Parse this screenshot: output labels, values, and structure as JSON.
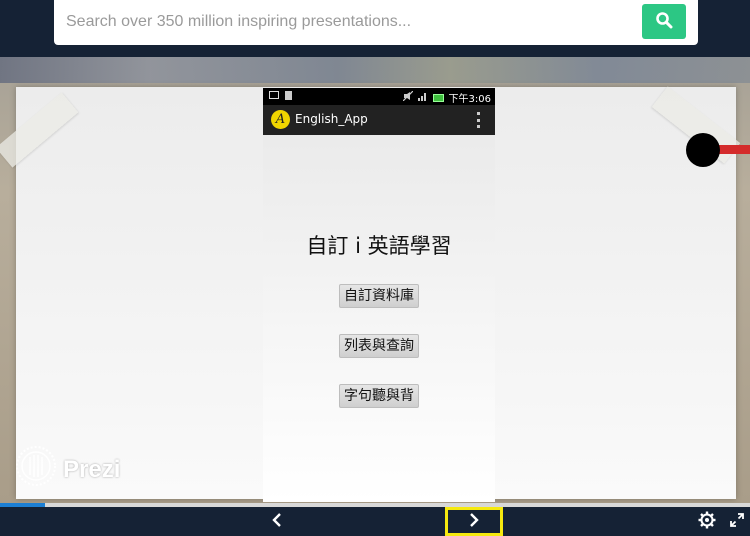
{
  "search": {
    "placeholder": "Search over 350 million inspiring presentations..."
  },
  "phone": {
    "status_time": "下午3:06",
    "app_name": "English_App",
    "app_logo_glyph": "A",
    "heading": "自訂 i 英語學習",
    "buttons": [
      {
        "label": "自訂資料庫"
      },
      {
        "label": "列表與查詢"
      },
      {
        "label": "字句聽與背"
      }
    ]
  },
  "branding": {
    "logo_text": "Prezi"
  },
  "progress": {
    "fraction": 0.06
  },
  "colors": {
    "header_bg": "#152235",
    "search_button": "#2cc784",
    "progress_fill": "#1c7fd4",
    "next_highlight": "#f5e90f",
    "pin_red": "#d42b2b"
  },
  "icons": {
    "search": "search-icon",
    "prev": "chevron-left-icon",
    "next": "chevron-right-icon",
    "settings": "gear-icon",
    "fullscreen": "expand-icon"
  }
}
